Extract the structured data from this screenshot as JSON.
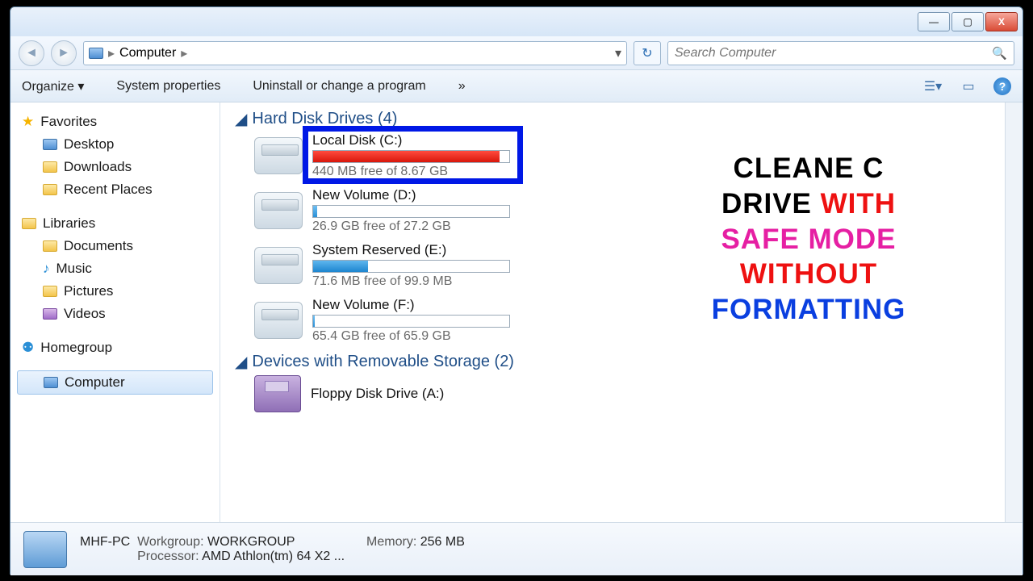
{
  "titlebar": {
    "min": "—",
    "max": "▢",
    "close": "X"
  },
  "address": {
    "root": "Computer",
    "dropdown": "▾",
    "refresh": "↻"
  },
  "search": {
    "placeholder": "Search Computer"
  },
  "toolbar": {
    "organize": "Organize ▾",
    "sysprops": "System properties",
    "uninstall": "Uninstall or change a program",
    "overflow": "»"
  },
  "sidebar": {
    "favorites": {
      "label": "Favorites",
      "items": [
        "Desktop",
        "Downloads",
        "Recent Places"
      ]
    },
    "libraries": {
      "label": "Libraries",
      "items": [
        "Documents",
        "Music",
        "Pictures",
        "Videos"
      ]
    },
    "homegroup": "Homegroup",
    "computer": "Computer"
  },
  "sections": {
    "hdd_title": "Hard Disk Drives (4)",
    "removable_title": "Devices with Removable Storage (2)"
  },
  "drives": [
    {
      "name": "Local Disk (C:)",
      "free": "440 MB free of 8.67 GB",
      "pct": 95,
      "color": "linear-gradient(#ff4b3e,#d8170b)",
      "highlighted": true
    },
    {
      "name": "New Volume (D:)",
      "free": "26.9 GB free of 27.2 GB",
      "pct": 2,
      "color": "linear-gradient(#6fbff2,#2a8fd6)"
    },
    {
      "name": "System Reserved (E:)",
      "free": "71.6 MB free of 99.9 MB",
      "pct": 28,
      "color": "linear-gradient(#5eb6ee,#1d85cf)"
    },
    {
      "name": "New Volume (F:)",
      "free": "65.4 GB free of 65.9 GB",
      "pct": 1,
      "color": "linear-gradient(#6fbff2,#2a8fd6)"
    }
  ],
  "removable": {
    "name": "Floppy Disk Drive (A:)"
  },
  "status": {
    "pcname": "MHF-PC",
    "workgroup_label": "Workgroup:",
    "workgroup": "WORKGROUP",
    "memory_label": "Memory:",
    "memory": "256 MB",
    "processor_label": "Processor:",
    "processor": "AMD Athlon(tm) 64 X2 ..."
  },
  "overlay": {
    "l1": "CLEANE C",
    "l2a": "DRIVE ",
    "l2b": "WITH",
    "l3": "SAFE MODE",
    "l4": "WITHOUT",
    "l5": "FORMATTING"
  }
}
